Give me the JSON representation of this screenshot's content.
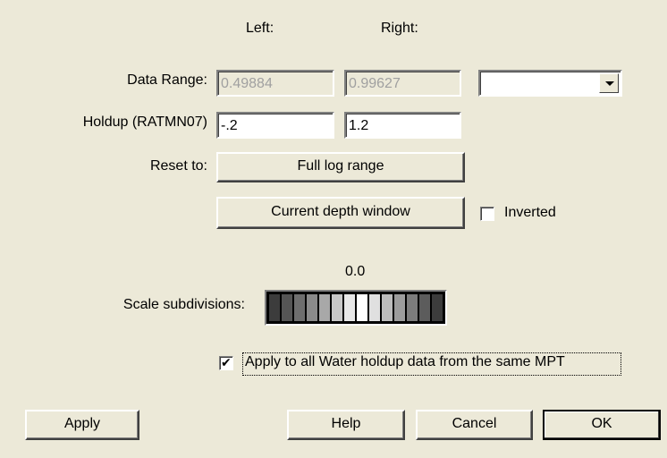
{
  "headers": {
    "left": "Left:",
    "right": "Right:"
  },
  "data_range": {
    "label": "Data Range:",
    "left_value": "0.49884",
    "right_value": "0.99627",
    "dropdown_value": ""
  },
  "holdup": {
    "label": "Holdup (RATMN07)",
    "left_value": "-.2",
    "right_value": "1.2"
  },
  "reset": {
    "label": "Reset to:",
    "full_log_range": "Full log range",
    "current_depth_window": "Current depth window"
  },
  "inverted": {
    "label": "Inverted",
    "checked": false
  },
  "scale": {
    "value": "0.0",
    "label": "Scale subdivisions:",
    "colors": [
      "#3c3c3c",
      "#555555",
      "#6e6e6e",
      "#8a8a8a",
      "#a8a8a8",
      "#c8c8c8",
      "#e8e8e8",
      "#ffffff",
      "#e0e0e0",
      "#bcbcbc",
      "#9c9c9c",
      "#7c7c7c",
      "#5c5c5c",
      "#3c3c3c"
    ]
  },
  "apply_all": {
    "label": "Apply to all Water holdup data from the same MPT",
    "checked": true
  },
  "buttons": {
    "apply": "Apply",
    "help": "Help",
    "cancel": "Cancel",
    "ok": "OK"
  }
}
